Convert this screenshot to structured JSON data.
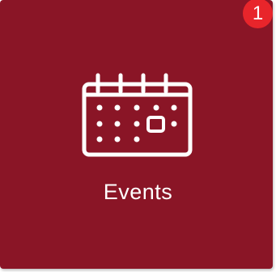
{
  "tile": {
    "label": "Events",
    "icon": "calendar-icon",
    "background_color": "#8a1526",
    "text_color": "#ffffff"
  },
  "badge": {
    "count": "1",
    "color": "#e8252b"
  }
}
